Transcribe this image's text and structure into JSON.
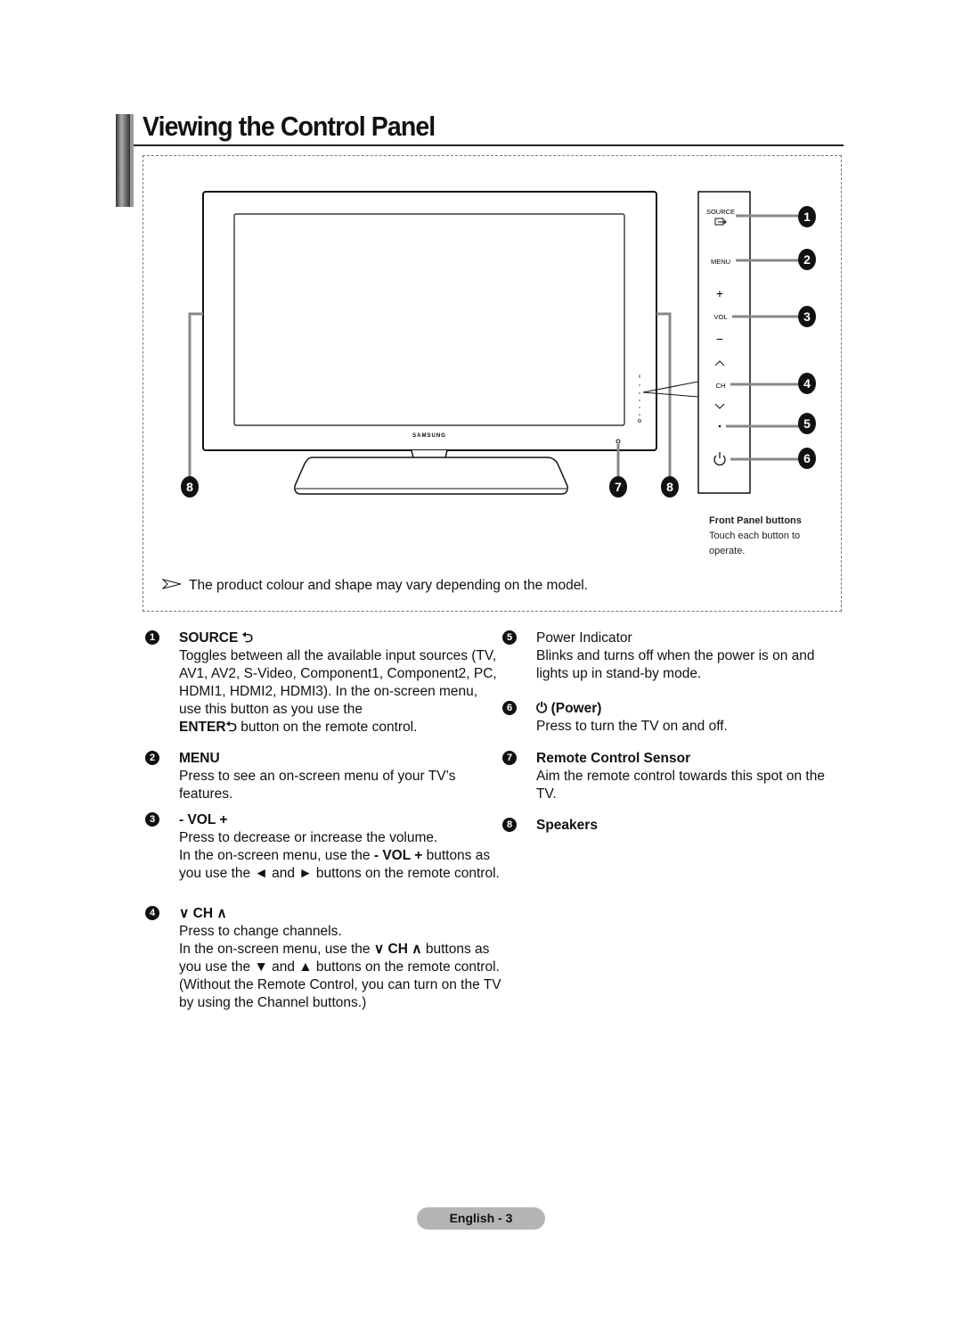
{
  "page_title": "Viewing the Control Panel",
  "diagram": {
    "brand": "SAMSUNG",
    "panel_labels": {
      "source": "SOURCE",
      "menu": "MENU",
      "vol_plus": "+",
      "vol": "VOL",
      "vol_minus": "−",
      "ch": "CH"
    },
    "callouts": [
      "1",
      "2",
      "3",
      "4",
      "5",
      "6",
      "7",
      "8"
    ],
    "front_panel_caption": {
      "title": "Front Panel buttons",
      "text": "Touch each button to operate."
    }
  },
  "note": "The product colour and shape may vary depending on the model.",
  "items": [
    {
      "num": "1",
      "head": "SOURCE ⮌",
      "body": [
        "Toggles between all the available input sources (TV, AV1, AV2, S-Video, Component1, Component2, PC, HDMI1, HDMI2, HDMI3). In the on-screen menu, use this button as you use the"
      ],
      "bold_tail": "ENTER⮌",
      "tail": " button on the remote control."
    },
    {
      "num": "2",
      "head": "MENU",
      "body": [
        "Press to see an on-screen menu of your TV’s features."
      ]
    },
    {
      "num": "3",
      "head": "- VOL +",
      "body": [
        "Press to decrease or increase the volume."
      ],
      "line2_pre": "In the on-screen menu, use the ",
      "line2_bold": "- VOL +",
      "line2_post": " buttons as you use the ◄ and ► buttons on the remote control."
    },
    {
      "num": "4",
      "head": "∨ CH ∧",
      "body": [
        "Press to change channels."
      ],
      "line2_pre": "In the on-screen menu, use the ",
      "line2_bold": "∨ CH ∧",
      "line2_post": " buttons  as you use the ▼ and ▲ buttons on the remote control.",
      "line3": "(Without the Remote Control, you can turn on the TV by using the Channel buttons.)"
    },
    {
      "num": "5",
      "head": "Power Indicator",
      "body": [
        "Blinks and turns off when the power is on and lights up in stand-by mode."
      ]
    },
    {
      "num": "6",
      "head": "⏻ (Power)",
      "body": [
        "Press to turn the TV on and off."
      ]
    },
    {
      "num": "7",
      "head": "Remote Control Sensor",
      "body": [
        "Aim the remote control towards this spot on the TV."
      ]
    },
    {
      "num": "8",
      "head": "Speakers",
      "body": []
    }
  ],
  "footer": "English - 3"
}
